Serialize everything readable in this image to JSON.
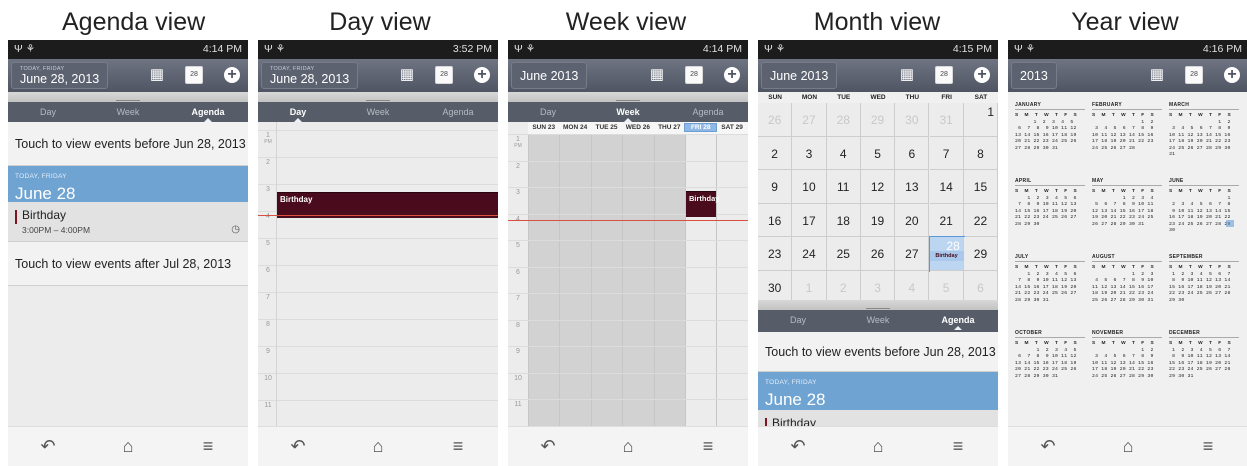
{
  "titles": [
    "Agenda view",
    "Day view",
    "Week view",
    "Month view",
    "Year view"
  ],
  "status_times": [
    "4:14 PM",
    "3:52 PM",
    "4:14 PM",
    "4:15 PM",
    "4:16 PM"
  ],
  "status_icons": {
    "left": "Ψ ⚘",
    "right": "▦ ☉ ▮ ∕ ▮"
  },
  "colors": {
    "header": "#5b616d",
    "today": "#6fa3d2",
    "event": "#4a0c1c",
    "now_line": "#d95040"
  },
  "header_icons": {
    "view_grid": "grid-icon",
    "today_cal": "28",
    "add": "+"
  },
  "tabs": [
    "Day",
    "Week",
    "Agenda"
  ],
  "agenda": {
    "date_small": "TODAY, FRIDAY",
    "date_big": "June 28, 2013",
    "before": "Touch to view events before Jun 28, 2013",
    "today_label": "TODAY, FRIDAY",
    "today_big": "June 28",
    "event_name": "Birthday",
    "event_time": "3:00PM – 4:00PM",
    "after": "Touch to view events after Jul 28, 2013"
  },
  "day": {
    "date_small": "TODAY, FRIDAY",
    "date_big": "June 28, 2013",
    "hours": [
      "1",
      "2",
      "3",
      "4",
      "5",
      "6",
      "7",
      "8",
      "9",
      "10",
      "11"
    ],
    "pm": "PM",
    "event": "Birthday"
  },
  "week": {
    "date": "June 2013",
    "days": [
      "SUN 23",
      "MON 24",
      "TUE 25",
      "WED 26",
      "THU 27",
      "FRI 28",
      "SAT 29"
    ],
    "event": "Birthday"
  },
  "month": {
    "date": "June 2013",
    "weekdays": [
      "SUN",
      "MON",
      "TUE",
      "WED",
      "THU",
      "FRI",
      "SAT"
    ],
    "cells": [
      "26",
      "27",
      "28",
      "29",
      "30",
      "31",
      "1",
      "2",
      "3",
      "4",
      "5",
      "6",
      "7",
      "8",
      "9",
      "10",
      "11",
      "12",
      "13",
      "14",
      "15",
      "16",
      "17",
      "18",
      "19",
      "20",
      "21",
      "22",
      "23",
      "24",
      "25",
      "26",
      "27",
      "28",
      "29",
      "30",
      "1",
      "2",
      "3",
      "4",
      "5",
      "6"
    ],
    "event": "Birthday",
    "before": "Touch to view events before Jun 28, 2013",
    "today_label": "TODAY, FRIDAY",
    "today_big": "June 28",
    "event_name": "Birthday"
  },
  "year": {
    "date": "2013",
    "dow": "S M T W T F S",
    "months": [
      {
        "name": "JANUARY",
        "rows": [
          "      1  2  3  4  5",
          " 6  7  8  9 10 11 12",
          "13 14 15 16 17 18 19",
          "20 21 22 23 24 25 26",
          "27 28 29 30 31"
        ]
      },
      {
        "name": "FEBRUARY",
        "rows": [
          "                1  2",
          " 3  4  5  6  7  8  9",
          "10 11 12 13 14 15 16",
          "17 18 19 20 21 22 23",
          "24 25 26 27 28"
        ]
      },
      {
        "name": "MARCH",
        "rows": [
          "                1  2",
          " 3  4  5  6  7  8  9",
          "10 11 12 13 14 15 16",
          "17 18 19 20 21 22 23",
          "24 25 26 27 28 29 30",
          "31"
        ]
      },
      {
        "name": "APRIL",
        "rows": [
          "    1  2  3  4  5  6",
          " 7  8  9 10 11 12 13",
          "14 15 16 17 18 19 20",
          "21 22 23 24 25 26 27",
          "28 29 30"
        ]
      },
      {
        "name": "MAY",
        "rows": [
          "          1  2  3  4",
          " 5  6  7  8  9 10 11",
          "12 13 14 15 16 17 18",
          "19 20 21 22 23 24 25",
          "26 27 28 29 30 31"
        ]
      },
      {
        "name": "JUNE",
        "rows": [
          "                   1",
          " 2  3  4  5  6  7  8",
          " 9 10 11 12 13 14 15",
          "16 17 18 19 20 21 22",
          "23 24 25 26 27 28 29",
          "30"
        ]
      },
      {
        "name": "JULY",
        "rows": [
          "    1  2  3  4  5  6",
          " 7  8  9 10 11 12 13",
          "14 15 16 17 18 19 20",
          "21 22 23 24 25 26 27",
          "28 29 30 31"
        ]
      },
      {
        "name": "AUGUST",
        "rows": [
          "             1  2  3",
          " 4  5  6  7  8  9 10",
          "11 12 13 14 15 16 17",
          "18 19 20 21 22 23 24",
          "25 26 27 28 29 30 31"
        ]
      },
      {
        "name": "SEPTEMBER",
        "rows": [
          " 1  2  3  4  5  6  7",
          " 8  9 10 11 12 13 14",
          "15 16 17 18 19 20 21",
          "22 23 24 25 26 27 28",
          "29 30"
        ]
      },
      {
        "name": "OCTOBER",
        "rows": [
          "       1  2  3  4  5",
          " 6  7  8  9 10 11 12",
          "13 14 15 16 17 18 19",
          "20 21 22 23 24 25 26",
          "27 28 29 30 31"
        ]
      },
      {
        "name": "NOVEMBER",
        "rows": [
          "                1  2",
          " 3  4  5  6  7  8  9",
          "10 11 12 13 14 15 16",
          "17 18 19 20 21 22 23",
          "24 25 26 27 28 29 30"
        ]
      },
      {
        "name": "DECEMBER",
        "rows": [
          " 1  2  3  4  5  6  7",
          " 8  9 10 11 12 13 14",
          "15 16 17 18 19 20 21",
          "22 23 24 25 26 27 28",
          "29 30 31"
        ]
      }
    ]
  },
  "nav": {
    "back": "↶",
    "home": "⌂",
    "menu": "≡"
  }
}
